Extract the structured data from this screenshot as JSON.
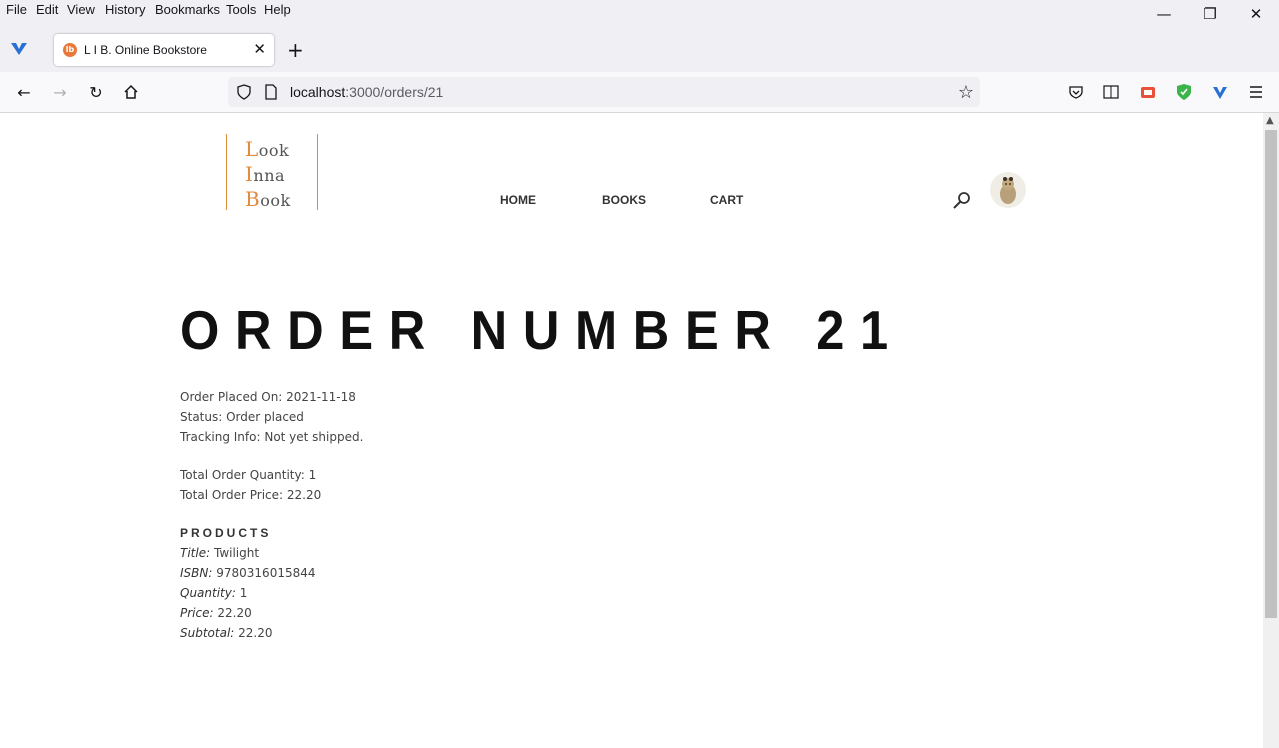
{
  "browser": {
    "menu": [
      "File",
      "Edit",
      "View",
      "History",
      "Bookmarks",
      "Tools",
      "Help"
    ],
    "tab_title": "L I B. Online Bookstore",
    "url_host": "localhost",
    "url_path": ":3000/orders/21"
  },
  "site": {
    "logo_lines": [
      {
        "initial": "L",
        "rest": "ook"
      },
      {
        "initial": "I",
        "rest": "nna"
      },
      {
        "initial": "B",
        "rest": "ook"
      }
    ],
    "nav": [
      "HOME",
      "BOOKS",
      "CART"
    ]
  },
  "order": {
    "heading": "ORDER NUMBER 21",
    "placed_on": "Order Placed On: 2021-11-18",
    "status": "Status: Order placed",
    "tracking": "Tracking Info: Not yet shipped.",
    "total_quantity": "Total Order Quantity: 1",
    "total_price": "Total Order Price: 22.20"
  },
  "products": {
    "heading": "PRODUCTS",
    "items": [
      {
        "title_label": "Title:",
        "title": "Twilight",
        "isbn_label": "ISBN:",
        "isbn": "9780316015844",
        "quantity_label": "Quantity:",
        "quantity": "1",
        "price_label": "Price:",
        "price": "22.20",
        "subtotal_label": "Subtotal:",
        "subtotal": "22.20"
      }
    ]
  }
}
